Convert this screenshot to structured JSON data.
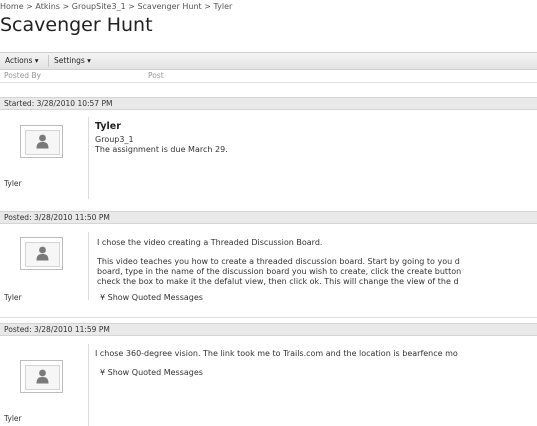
{
  "breadcrumb": "Home > Atkins > GroupSite3_1 > Scavenger Hunt > Tyler",
  "page_title": "Scavenger Hunt",
  "toolbar": {
    "actions": "Actions ▾",
    "settings": "Settings ▾"
  },
  "columns": {
    "posted_by": "Posted By",
    "post": "Post"
  },
  "posts": [
    {
      "header": "Started: 3/28/2010 10:57 PM",
      "author": "Tyler",
      "title": "Tyler",
      "group": "Group3_1",
      "body": "The assignment is due March 29."
    },
    {
      "header": "Posted: 3/28/2010 11:50 PM",
      "author": "Tyler",
      "line1": "I chose the video creating a Threaded Discussion Board.",
      "line2": "This video teaches you how to create a threaded discussion board. Start by going to you d",
      "line3": "board, type in the name of the discussion board you wish to create, click the create button",
      "line4": "check the box to make it the defalut view, then click ok. This will change the view of the d",
      "show_quoted": "Show Quoted Messages"
    },
    {
      "header": "Posted: 3/28/2010 11:59 PM",
      "author": "Tyler",
      "line1": "I chose 360-degree vision. The link took me to Trails.com and the location is bearfence mo",
      "show_quoted": "Show Quoted Messages"
    }
  ]
}
